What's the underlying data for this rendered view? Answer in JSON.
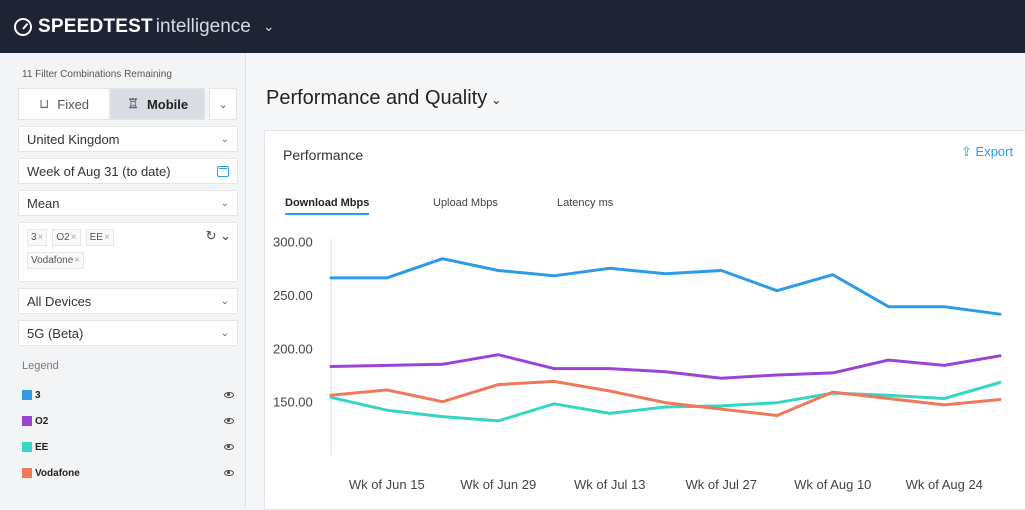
{
  "header": {
    "brand_bold": "SPEEDTEST",
    "brand_light": "intelligence",
    "caret": "⌄"
  },
  "sidebar": {
    "remaining": "11 Filter Combinations Remaining",
    "segment": {
      "fixed": "Fixed",
      "mobile": "Mobile",
      "selected": "Mobile"
    },
    "country": "United Kingdom",
    "week": "Week of Aug 31 (to date)",
    "aggregate": "Mean",
    "providers": [
      "3",
      "O2",
      "EE",
      "Vodafone"
    ],
    "devices": "All Devices",
    "technology": "5G (Beta)",
    "legend_title": "Legend",
    "legend": [
      {
        "label": "3",
        "color": "#2d9be6"
      },
      {
        "label": "O2",
        "color": "#9b43d8"
      },
      {
        "label": "EE",
        "color": "#36d6c3"
      },
      {
        "label": "Vodafone",
        "color": "#f0795a"
      }
    ]
  },
  "main": {
    "title": "Performance and Quality",
    "panel_title": "Performance",
    "export_label": "Export",
    "tabs": [
      {
        "label": "Download Mbps",
        "active": true
      },
      {
        "label": "Upload Mbps",
        "active": false
      },
      {
        "label": "Latency ms",
        "active": false
      }
    ]
  },
  "chart_data": {
    "type": "line",
    "x": [
      "Jun 8",
      "Jun 15",
      "Jun 22",
      "Jun 29",
      "Jul 6",
      "Jul 13",
      "Jul 20",
      "Jul 27",
      "Aug 3",
      "Aug 10",
      "Aug 17",
      "Aug 24",
      "Aug 31"
    ],
    "x_tick_labels": [
      "Wk of Jun 15",
      "Wk of Jun 29",
      "Wk of Jul 13",
      "Wk of Jul 27",
      "Wk of Aug 10",
      "Wk of Aug 24"
    ],
    "ylim": [
      100,
      310
    ],
    "y_ticks": [
      "300.00",
      "250.00",
      "200.00",
      "150.00"
    ],
    "series": [
      {
        "name": "3",
        "color": "#2d9be6",
        "values": [
          266,
          266,
          284,
          273,
          268,
          275,
          270,
          273,
          254,
          269,
          239,
          239,
          232
        ]
      },
      {
        "name": "O2",
        "color": "#9b43d8",
        "values": [
          183,
          184,
          185,
          194,
          181,
          181,
          178,
          172,
          175,
          177,
          189,
          184,
          193
        ]
      },
      {
        "name": "EE",
        "color": "#36d6c3",
        "values": [
          154,
          142,
          136,
          132,
          148,
          139,
          145,
          146,
          149,
          158,
          156,
          153,
          168
        ]
      },
      {
        "name": "Vodafone",
        "color": "#f0795a",
        "values": [
          156,
          161,
          150,
          166,
          169,
          160,
          149,
          143,
          137,
          159,
          153,
          147,
          152
        ]
      }
    ]
  }
}
